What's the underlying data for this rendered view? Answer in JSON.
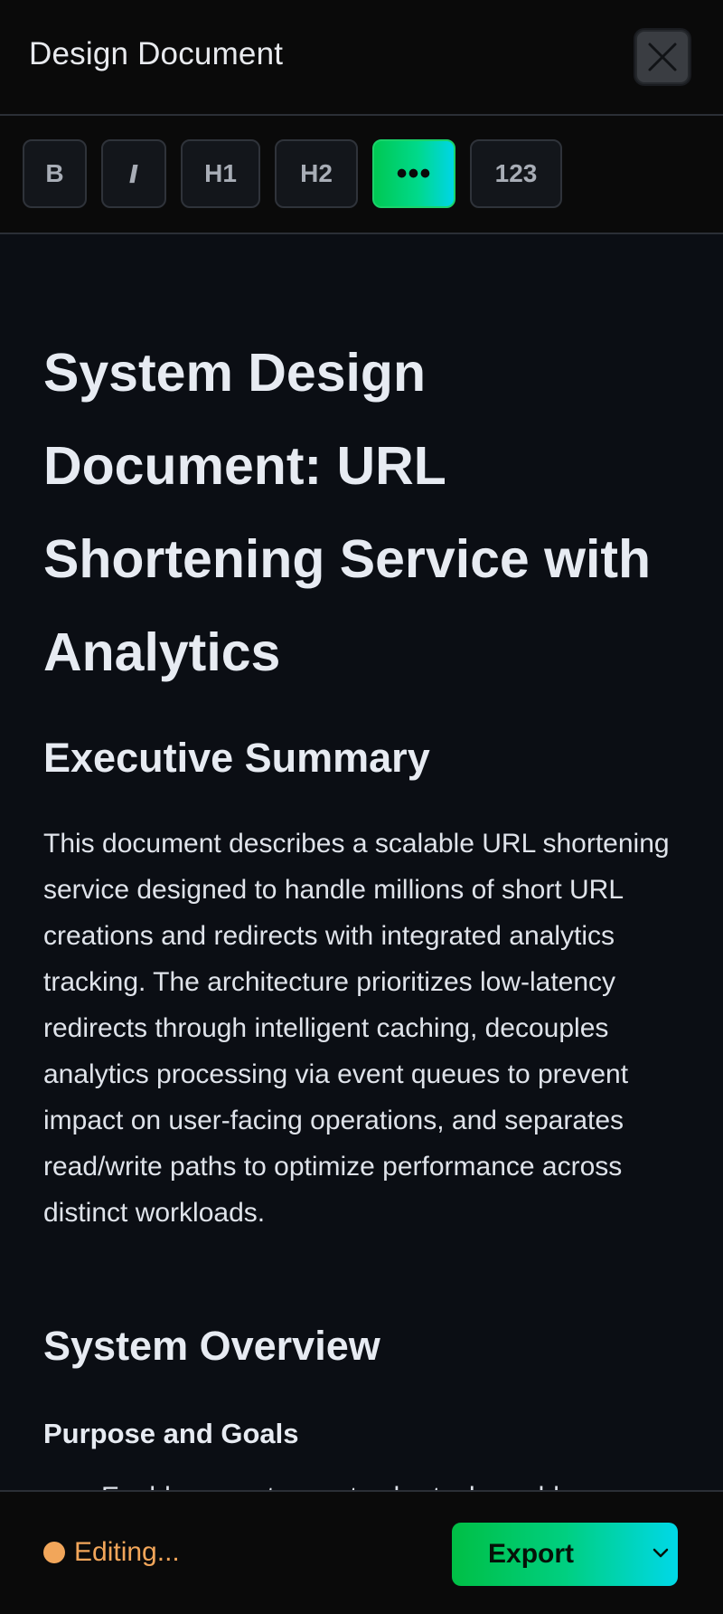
{
  "header": {
    "title": "Design Document",
    "close_icon": "close-icon"
  },
  "toolbar": {
    "bold_label": "B",
    "italic_label": "I",
    "h1_label": "H1",
    "h2_label": "H2",
    "more_label": "•••",
    "numbered_label": "123",
    "active_color": "#00d98b"
  },
  "document": {
    "title": "System Design Document: URL Shortening Service with Analytics",
    "sections": [
      {
        "heading": "Executive Summary",
        "body": "This document describes a scalable URL shortening service designed to handle millions of short URL creations and redirects with integrated analytics tracking. The architecture prioritizes low-latency redirects through intelligent caching, decouples analytics processing via event queues to prevent impact on user-facing operations, and separates read/write paths to optimize performance across distinct workloads."
      },
      {
        "heading": "System Overview",
        "subheading": "Purpose and Goals",
        "list_peek": "Enable users to create short, shareable"
      }
    ]
  },
  "footer": {
    "status_text": "Editing...",
    "status_color": "#f2a65a",
    "export_label": "Export",
    "export_icon": "chevron-down-icon"
  }
}
